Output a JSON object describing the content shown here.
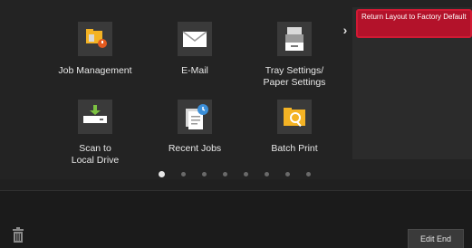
{
  "apps": [
    {
      "id": "job-management",
      "label": "Job Management",
      "icon": "job-management-icon"
    },
    {
      "id": "email",
      "label": "E-Mail",
      "icon": "email-icon"
    },
    {
      "id": "tray-settings",
      "label": "Tray Settings/\nPaper Settings",
      "icon": "tray-settings-icon"
    },
    {
      "id": "scan-local",
      "label": "Scan to\nLocal Drive",
      "icon": "scan-to-local-drive-icon"
    },
    {
      "id": "recent-jobs",
      "label": "Recent Jobs",
      "icon": "recent-jobs-icon"
    },
    {
      "id": "batch-print",
      "label": "Batch Print",
      "icon": "batch-print-icon"
    }
  ],
  "side_panel": {
    "arrow": "›",
    "reset_label": "Return Layout to Factory Default"
  },
  "pagination": {
    "pages": 8,
    "active": 1
  },
  "bottom": {
    "edit_end_label": "Edit End"
  },
  "colors": {
    "accent_red": "#b3122a",
    "background": "#232323"
  }
}
